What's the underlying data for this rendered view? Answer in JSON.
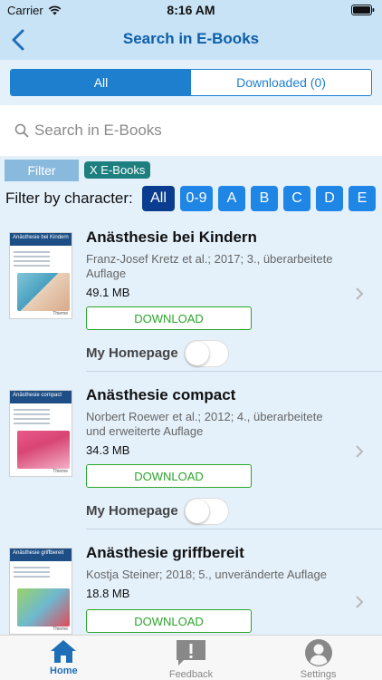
{
  "status_bar": {
    "carrier": "Carrier",
    "time": "8:16 AM"
  },
  "nav": {
    "title": "Search in E-Books",
    "back_icon": "chevron-left-icon"
  },
  "segments": [
    {
      "label": "All",
      "active": true
    },
    {
      "label": "Downloaded (0)",
      "active": false
    }
  ],
  "search": {
    "placeholder": "Search in E-Books",
    "value": ""
  },
  "filter": {
    "button_label": "Filter",
    "chip_label": "X E-Books"
  },
  "char_filter": {
    "label": "Filter by character:",
    "options": [
      "All",
      "0-9",
      "A",
      "B",
      "C",
      "D",
      "E"
    ],
    "selected": "All"
  },
  "books": [
    {
      "title": "Anästhesie bei Kindern",
      "meta": "Franz-Josef Kretz et al.; 2017; 3., überarbeitete Auflage",
      "size": "49.1 MB",
      "download_label": "DOWNLOAD",
      "homepage_label": "My Homepage",
      "homepage_on": false,
      "cover_title": "Anästhesie bei Kindern",
      "cover_color": "#1d4f86"
    },
    {
      "title": "Anästhesie compact",
      "meta": "Norbert Roewer et al.; 2012; 4., überarbeitete und erweiterte Auflage",
      "size": "34.3 MB",
      "download_label": "DOWNLOAD",
      "homepage_label": "My Homepage",
      "homepage_on": false,
      "cover_title": "Anästhesie compact",
      "cover_color": "#1d4f86"
    },
    {
      "title": "Anästhesie griffbereit",
      "meta": "Kostja Steiner; 2018; 5., unveränderte Auflage",
      "size": "18.8 MB",
      "download_label": "DOWNLOAD",
      "homepage_label": "",
      "homepage_on": false,
      "cover_title": "Anästhesie griffbereit",
      "cover_color": "#1d4f86"
    }
  ],
  "tabs": [
    {
      "label": "Home",
      "icon": "home-icon",
      "active": true
    },
    {
      "label": "Feedback",
      "icon": "feedback-icon",
      "active": false
    },
    {
      "label": "Settings",
      "icon": "person-icon",
      "active": false
    }
  ]
}
